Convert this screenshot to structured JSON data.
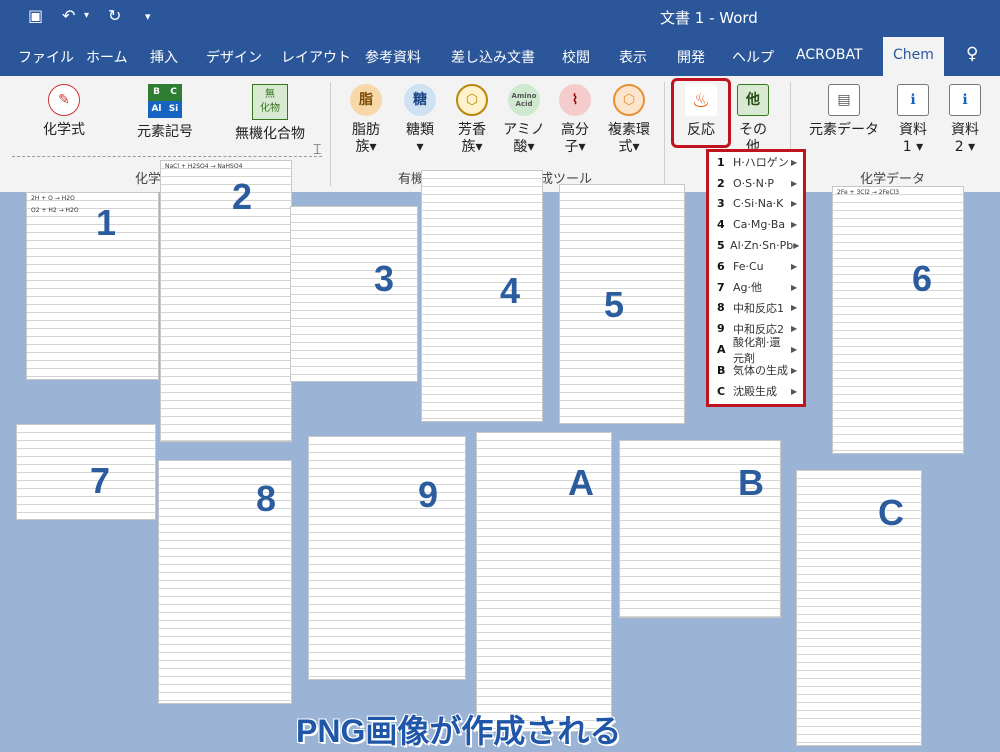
{
  "titlebar": {
    "title": "文書 1  -  Word"
  },
  "menu": {
    "tabs": [
      "ファイル",
      "ホーム",
      "挿入",
      "デザイン",
      "レイアウト",
      "参考資料",
      "差し込み文書",
      "校閲",
      "表示",
      "開発",
      "ヘルプ",
      "ACROBAT",
      "Chem"
    ]
  },
  "ribbon": {
    "chemical_formula": "化学式",
    "element_symbol": "元素記号",
    "element_icon": [
      "B",
      "C",
      "Al",
      "Si"
    ],
    "inorganic_compound": "無機化合物",
    "inorganic_icon": [
      "無",
      "化物"
    ],
    "fat": [
      "脂肪",
      "族▾"
    ],
    "fat_icon": "脂",
    "sugar": [
      "糖類",
      "▾"
    ],
    "sugar_icon": "糖",
    "aromatic": [
      "芳香",
      "族▾"
    ],
    "amino": [
      "アミノ",
      "酸▾"
    ],
    "amino_icon": [
      "Amino",
      "Acid"
    ],
    "polymer": [
      "高分",
      "子▾"
    ],
    "heterocyclic": [
      "複素環",
      "式▾"
    ],
    "reaction": "反応",
    "other": [
      "その",
      "他"
    ],
    "other_icon": "他",
    "element_data": "元素データ",
    "material1": [
      "資料",
      "1 ▾"
    ],
    "material2": [
      "資料",
      "2 ▾"
    ],
    "group_formula": "化学式作",
    "group_organic": "有機",
    "group_tools": "成ツール",
    "group_chemdata": "化学データ"
  },
  "dropdown": {
    "items": [
      {
        "num": "1",
        "label": "H·ハロゲン"
      },
      {
        "num": "2",
        "label": "O·S·N·P"
      },
      {
        "num": "3",
        "label": "C·Si·Na·K"
      },
      {
        "num": "4",
        "label": "Ca·Mg·Ba"
      },
      {
        "num": "5",
        "label": "Al·Zn·Sn·Pb"
      },
      {
        "num": "6",
        "label": "Fe·Cu"
      },
      {
        "num": "7",
        "label": "Ag·他"
      },
      {
        "num": "8",
        "label": "中和反応1"
      },
      {
        "num": "9",
        "label": "中和反応2"
      },
      {
        "num": "A",
        "label": "酸化剤·還元剤"
      },
      {
        "num": "B",
        "label": "気体の生成"
      },
      {
        "num": "C",
        "label": "沈殿生成"
      }
    ]
  },
  "panels": {
    "badges": [
      "1",
      "2",
      "3",
      "4",
      "5",
      "6",
      "7",
      "8",
      "9",
      "A",
      "B",
      "C"
    ],
    "sample_lines": [
      "2H + O → H2O",
      "O2 + H2 → H2O",
      "NaCl + H2SO4 → NaHSO4",
      "2Fe + 3Cl2 → 2FeCl3"
    ]
  },
  "caption": "PNG画像が作成される"
}
